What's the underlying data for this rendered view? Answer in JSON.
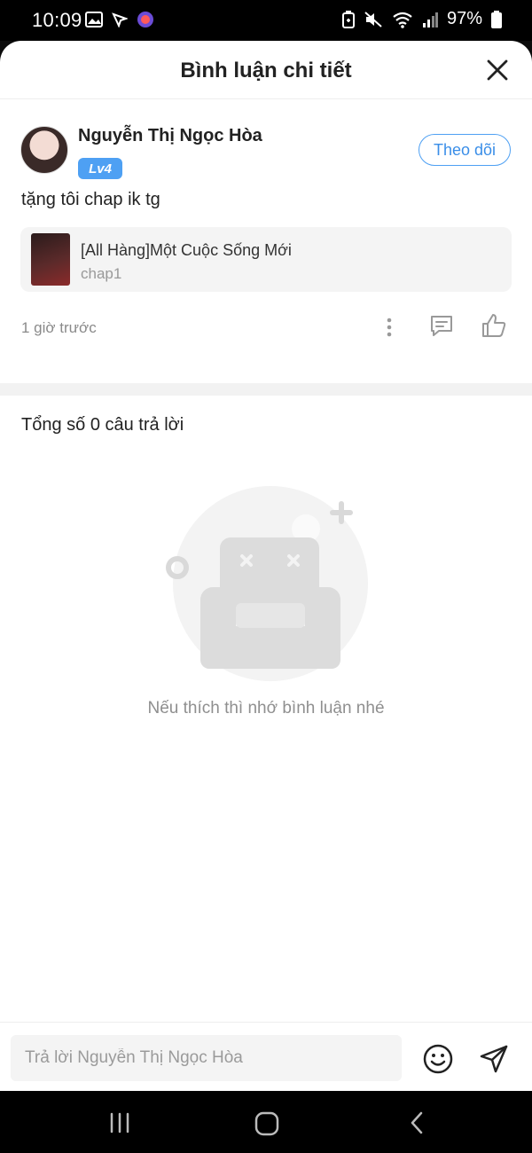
{
  "status_bar": {
    "time": "10:09",
    "battery_percent": "97%",
    "left_icons": [
      "image-icon",
      "navigation-icon",
      "app-icon"
    ],
    "right_icons": [
      "battery-saver-icon",
      "mute-icon",
      "wifi-icon",
      "signal-icon",
      "battery-icon"
    ]
  },
  "header": {
    "title": "Bình luận chi tiết"
  },
  "comment": {
    "username": "Nguyễn Thị Ngọc Hòa",
    "level": "Lv4",
    "follow_label": "Theo dõi",
    "text": "tặng tôi chap ik tg",
    "story": {
      "title": "[All Hàng]Một Cuộc Sống Mới",
      "chapter": "chap1"
    },
    "time_ago": "1 giờ trước"
  },
  "replies": {
    "total_label": "Tổng số 0 câu trả lời",
    "empty_text": "Nếu thích thì nhớ bình luận nhé"
  },
  "reply_bar": {
    "placeholder": "Trả lời Nguyễn Thị Ngọc Hòa"
  },
  "colors": {
    "accent": "#4ea0f3",
    "text_primary": "#222222",
    "text_secondary": "#8a8a8a",
    "sheet_bg": "#ffffff",
    "band_bg": "#f2f2f2"
  }
}
